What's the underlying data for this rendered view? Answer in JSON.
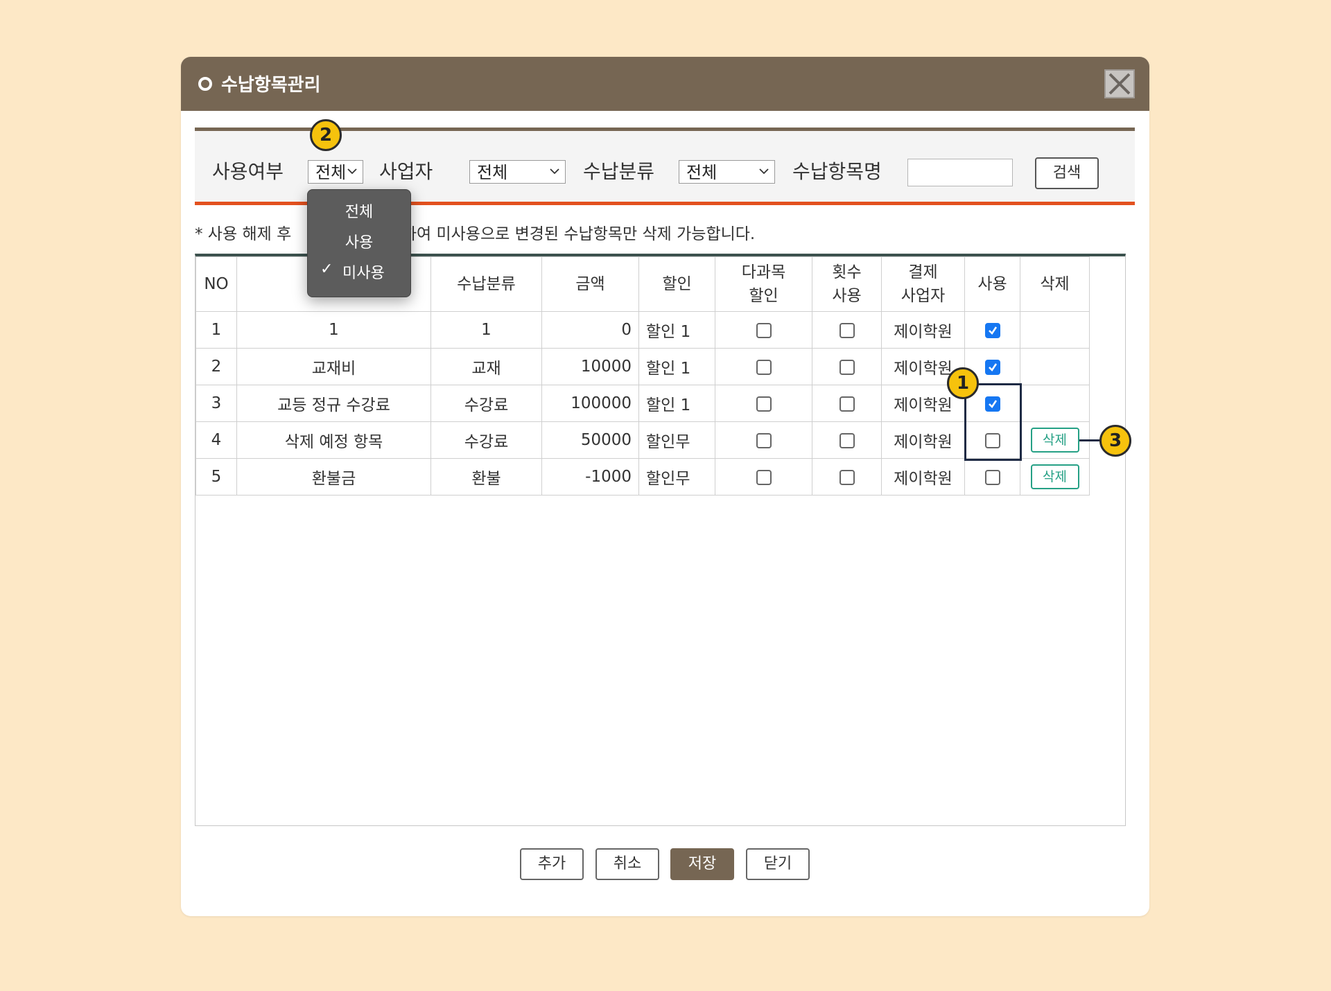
{
  "dialog": {
    "title": "수납항목관리"
  },
  "search": {
    "usage_label": "사용여부",
    "usage_value": "전체",
    "business_label": "사업자",
    "business_value": "전체",
    "category_label": "수납분류",
    "category_value": "전체",
    "item_name_label": "수납항목명",
    "item_name_value": "",
    "search_button": "검색"
  },
  "usage_dropdown": {
    "options": [
      "전체",
      "사용",
      "미사용"
    ],
    "checked": "미사용",
    "check_mark": "✓"
  },
  "notice": {
    "before": "* 사용 해제 후",
    "after": "하여 미사용으로 변경된 수납항목만 삭제 가능합니다."
  },
  "table": {
    "headers": {
      "no": "NO",
      "item_name_partial": "수",
      "category": "수납분류",
      "amount": "금액",
      "discount": "할인",
      "multi_discount_1": "다과목",
      "multi_discount_2": "할인",
      "count_use_1": "횟수",
      "count_use_2": "사용",
      "payment_biz_1": "결제",
      "payment_biz_2": "사업자",
      "use": "사용",
      "delete": "삭제"
    },
    "rows": [
      {
        "no": "1",
        "name": "1",
        "category": "1",
        "amount": "0",
        "discount": "할인 1",
        "multi": false,
        "count": false,
        "biz": "제이학원",
        "use": true,
        "delete": ""
      },
      {
        "no": "2",
        "name": "교재비",
        "category": "교재",
        "amount": "10000",
        "discount": "할인 1",
        "multi": false,
        "count": false,
        "biz": "제이학원",
        "use": true,
        "delete": ""
      },
      {
        "no": "3",
        "name": "교등 정규 수강료",
        "category": "수강료",
        "amount": "100000",
        "discount": "할인 1",
        "multi": false,
        "count": false,
        "biz": "제이학원",
        "use": true,
        "delete": ""
      },
      {
        "no": "4",
        "name": "삭제 예정 항목",
        "category": "수강료",
        "amount": "50000",
        "discount": "할인무",
        "multi": false,
        "count": false,
        "biz": "제이학원",
        "use": false,
        "delete": "삭제"
      },
      {
        "no": "5",
        "name": "환불금",
        "category": "환불",
        "amount": "-1000",
        "discount": "할인무",
        "multi": false,
        "count": false,
        "biz": "제이학원",
        "use": false,
        "delete": "삭제"
      }
    ]
  },
  "buttons": {
    "add": "추가",
    "cancel": "취소",
    "save": "저장",
    "close": "닫기"
  },
  "callouts": [
    "1",
    "2",
    "3"
  ],
  "colors": {
    "titlebar": "#766653",
    "accent_line": "#e3511f",
    "checkbox_checked": "#1677f2",
    "delete_button": "#25a085",
    "callout": "#f6c20d",
    "background": "#fde8c6"
  }
}
